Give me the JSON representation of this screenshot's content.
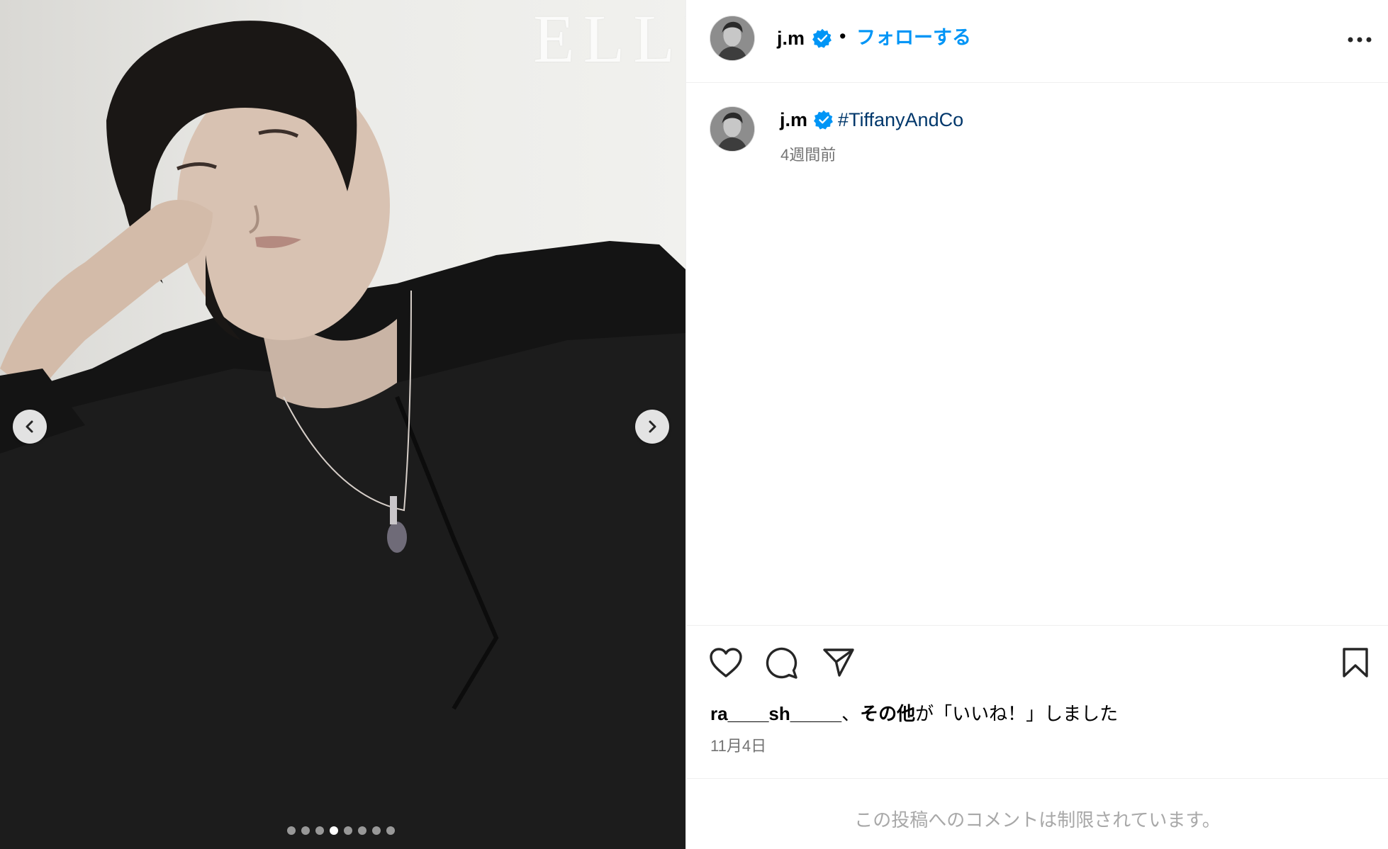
{
  "media": {
    "watermark": "ELLE",
    "carousel_count": 8,
    "carousel_active_index": 3
  },
  "header": {
    "username": "j.m",
    "separator": "•",
    "follow_label": "フォローする"
  },
  "caption": {
    "username": "j.m",
    "hashtag": "#TiffanyAndCo",
    "time": "4週間前"
  },
  "engagement": {
    "liked_by_user": "ra____sh_____",
    "liked_by_mid": "、",
    "liked_by_others": "その他",
    "liked_by_suffix": "が「いいね！」しました",
    "date": "11月4日"
  },
  "comments": {
    "restricted_notice": "この投稿へのコメントは制限されています。"
  },
  "colors": {
    "link_blue": "#0095f6",
    "hashtag": "#00376b",
    "verified": "#0095f6",
    "muted": "#737373",
    "divider": "#efefef"
  },
  "icons": {
    "prev": "chevron-left-icon",
    "next": "chevron-right-icon",
    "more": "more-horizontal-icon",
    "like": "heart-icon",
    "comment": "comment-icon",
    "share": "paper-plane-icon",
    "save": "bookmark-icon",
    "verified": "verified-badge-icon"
  }
}
